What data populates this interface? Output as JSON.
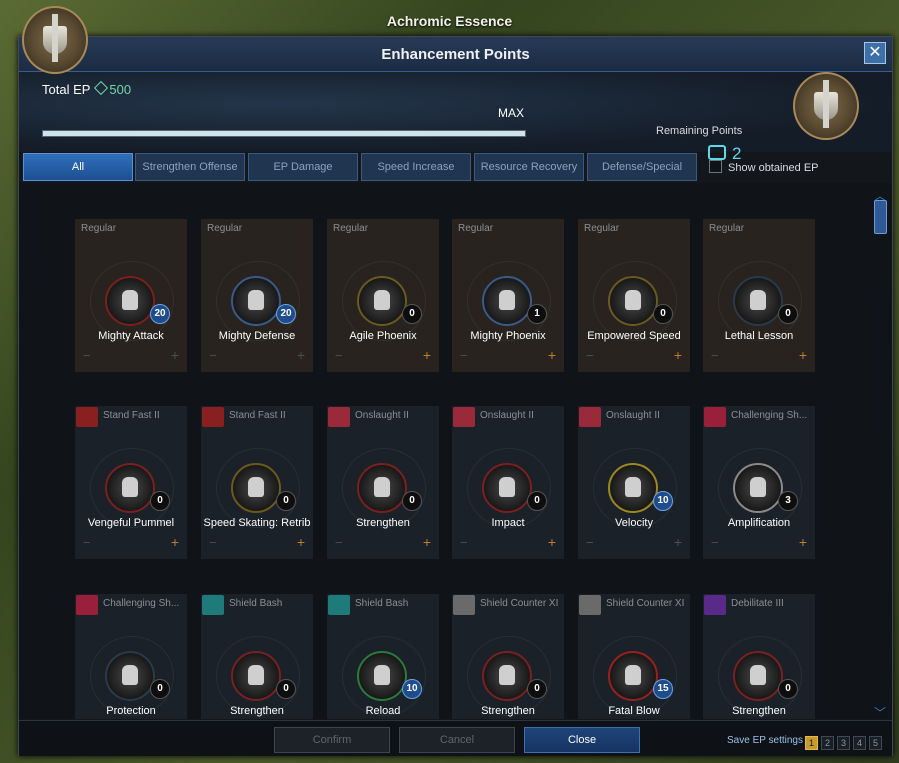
{
  "outer_title": "Achromic Essence",
  "window": {
    "title": "Enhancement Points",
    "close_icon": "✕"
  },
  "header": {
    "total_ep_label": "Total EP",
    "total_ep_value": "500",
    "max_label": "MAX",
    "ep_progress": 1.0,
    "remaining_label": "Remaining Points",
    "remaining_value": "2"
  },
  "tabs": [
    {
      "label": "All",
      "active": true
    },
    {
      "label": "Strengthen Offense",
      "active": false
    },
    {
      "label": "EP Damage",
      "active": false
    },
    {
      "label": "Speed Increase",
      "active": false
    },
    {
      "label": "Resource Recovery",
      "active": false
    },
    {
      "label": "Defense/Special",
      "active": false
    }
  ],
  "show_obtained_label": "Show obtained EP",
  "cards": [
    {
      "category": "Regular",
      "name": "Mighty Attack",
      "level": "20",
      "blue": true,
      "ring": "#7a2020",
      "regular": true,
      "plus_active": false
    },
    {
      "category": "Regular",
      "name": "Mighty Defense",
      "level": "20",
      "blue": true,
      "ring": "#3a5a8a",
      "regular": true,
      "plus_active": false
    },
    {
      "category": "Regular",
      "name": "Agile Phoenix",
      "level": "0",
      "blue": false,
      "ring": "#6a5a20",
      "regular": true,
      "plus_active": true
    },
    {
      "category": "Regular",
      "name": "Mighty Phoenix",
      "level": "1",
      "blue": false,
      "ring": "#3a5a8a",
      "regular": true,
      "plus_active": true
    },
    {
      "category": "Regular",
      "name": "Empowered Speed",
      "level": "0",
      "blue": false,
      "ring": "#6a5a20",
      "regular": true,
      "plus_active": true
    },
    {
      "category": "Regular",
      "name": "Lethal Lesson",
      "level": "0",
      "blue": false,
      "ring": "#2a3a4a",
      "regular": true,
      "plus_active": true
    },
    {
      "category": "Stand Fast II",
      "name": "Vengeful Pummel",
      "level": "0",
      "blue": false,
      "ring": "#7a2020",
      "icon": "#8a1f1f",
      "plus_active": true
    },
    {
      "category": "Stand Fast II",
      "name": "Speed Skating: Retrib",
      "level": "0",
      "blue": false,
      "ring": "#6a5a20",
      "icon": "#8a1f1f",
      "plus_active": true
    },
    {
      "category": "Onslaught II",
      "name": "Strengthen",
      "level": "0",
      "blue": false,
      "ring": "#7a2020",
      "icon": "#9a2a3a",
      "plus_active": true
    },
    {
      "category": "Onslaught II",
      "name": "Impact",
      "level": "0",
      "blue": false,
      "ring": "#7a2020",
      "icon": "#9a2a3a",
      "plus_active": true
    },
    {
      "category": "Onslaught II",
      "name": "Velocity",
      "level": "10",
      "blue": true,
      "ring": "#9a8a20",
      "icon": "#9a2a3a",
      "plus_active": false
    },
    {
      "category": "Challenging Sh...",
      "name": "Amplification",
      "level": "3",
      "blue": false,
      "ring": "#8a8a8a",
      "icon": "#9a1f3a",
      "plus_active": true
    },
    {
      "category": "Challenging Sh...",
      "name": "Protection",
      "level": "0",
      "blue": false,
      "ring": "#2a3a4a",
      "icon": "#9a1f3a",
      "plus_active": true
    },
    {
      "category": "Shield Bash",
      "name": "Strengthen",
      "level": "0",
      "blue": false,
      "ring": "#7a2020",
      "icon": "#1f7a7a",
      "plus_active": true
    },
    {
      "category": "Shield Bash",
      "name": "Reload",
      "level": "10",
      "blue": true,
      "ring": "#2a7a3a",
      "icon": "#1f7a7a",
      "plus_active": false
    },
    {
      "category": "Shield Counter XI",
      "name": "Strengthen",
      "level": "0",
      "blue": false,
      "ring": "#7a2020",
      "icon": "#6a6a6a",
      "plus_active": true
    },
    {
      "category": "Shield Counter XI",
      "name": "Fatal Blow",
      "level": "15",
      "blue": true,
      "ring": "#9a2020",
      "icon": "#6a6a6a",
      "plus_active": false
    },
    {
      "category": "Debilitate III",
      "name": "Strengthen",
      "level": "0",
      "blue": false,
      "ring": "#7a2020",
      "icon": "#5a2a8a",
      "plus_active": true
    }
  ],
  "footer": {
    "confirm_label": "Confirm",
    "cancel_label": "Cancel",
    "close_label": "Close",
    "save_settings_label": "Save EP settings",
    "pages": [
      "1",
      "2",
      "3",
      "4",
      "5"
    ],
    "active_page": "1"
  }
}
